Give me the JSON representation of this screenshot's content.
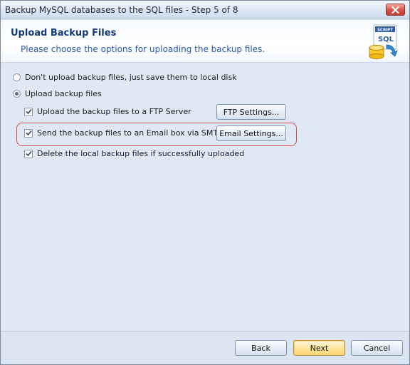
{
  "window": {
    "title": "Backup MySQL databases to the SQL files - Step 5 of 8"
  },
  "header": {
    "title": "Upload Backup Files",
    "subtitle": "Please choose the options for uploading the backup files.",
    "logo_text_top": "SCRIPT",
    "logo_text_main": "SQL"
  },
  "options": {
    "radio_no_upload": {
      "label": "Don't upload backup files, just save them to local disk",
      "checked": false
    },
    "radio_upload": {
      "label": "Upload backup files",
      "checked": true
    },
    "check_ftp": {
      "label": "Upload the backup files to a FTP Server",
      "checked": true
    },
    "check_email": {
      "label": "Send the backup files to an Email box via SMTP",
      "checked": true
    },
    "check_delete": {
      "label": "Delete the local backup files if successfully uploaded",
      "checked": true
    }
  },
  "buttons": {
    "ftp_settings": "FTP Settings...",
    "email_settings": "Email Settings...",
    "back": "Back",
    "next": "Next",
    "cancel": "Cancel"
  },
  "colors": {
    "header_title": "#123a7a",
    "header_sub": "#2a5aa6",
    "highlight_border": "#d9484a",
    "close_button": "#d9564a"
  }
}
